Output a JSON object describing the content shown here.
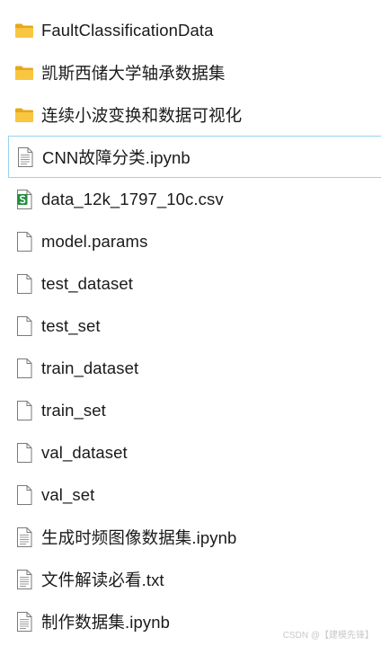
{
  "files": [
    {
      "name": "FaultClassificationData",
      "icon": "folder-icon"
    },
    {
      "name": "凯斯西储大学轴承数据集",
      "icon": "folder-icon"
    },
    {
      "name": "连续小波变换和数据可视化",
      "icon": "folder-icon"
    },
    {
      "name": "CNN故障分类.ipynb",
      "icon": "text-file-icon",
      "selected": true
    },
    {
      "name": "data_12k_1797_10c.csv",
      "icon": "spreadsheet-file-icon"
    },
    {
      "name": "model.params",
      "icon": "blank-file-icon"
    },
    {
      "name": "test_dataset",
      "icon": "blank-file-icon"
    },
    {
      "name": "test_set",
      "icon": "blank-file-icon"
    },
    {
      "name": "train_dataset",
      "icon": "blank-file-icon"
    },
    {
      "name": "train_set",
      "icon": "blank-file-icon"
    },
    {
      "name": "val_dataset",
      "icon": "blank-file-icon"
    },
    {
      "name": "val_set",
      "icon": "blank-file-icon"
    },
    {
      "name": "生成时频图像数据集.ipynb",
      "icon": "text-file-icon"
    },
    {
      "name": "文件解读必看.txt",
      "icon": "text-file-icon"
    },
    {
      "name": "制作数据集.ipynb",
      "icon": "text-file-icon"
    }
  ],
  "watermark": "CSDN @【建模先锋】",
  "colors": {
    "folder": "#f8c640",
    "folder_dark": "#e6a817",
    "selection_border": "#99d1ef",
    "csv_green": "#1d8f3a"
  }
}
